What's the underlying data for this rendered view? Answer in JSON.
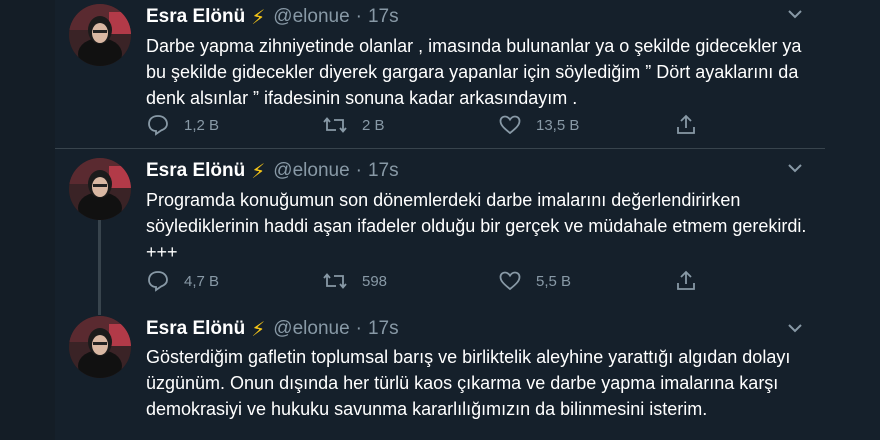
{
  "tweets": [
    {
      "name": "Esra Elönü",
      "badge": "⚡",
      "handle": "@elonue",
      "separator": "·",
      "time": "17s",
      "text": "Darbe yapma zihniyetinde olanlar , imasında bulunanlar ya o şekilde gidecekler ya bu şekilde gidecekler diyerek gargara yapanlar için söylediğim ” Dört ayaklarını da denk alsınlar ” ifadesinin sonuna kadar arkasındayım .",
      "replies": "1,2 B",
      "retweets": "2 B",
      "likes": "13,5 B"
    },
    {
      "name": "Esra Elönü",
      "badge": "⚡",
      "handle": "@elonue",
      "separator": "·",
      "time": "17s",
      "text": "Programda konuğumun son dönemlerdeki darbe imalarını değerlendirirken söylediklerinin haddi aşan ifadeler olduğu bir gerçek ve müdahale etmem gerekirdi. +++",
      "replies": "4,7 B",
      "retweets": "598",
      "likes": "5,5 B"
    },
    {
      "name": "Esra Elönü",
      "badge": "⚡",
      "handle": "@elonue",
      "separator": "·",
      "time": "17s",
      "text": "Gösterdiğim gafletin toplumsal barış ve birliktelik aleyhine yarattığı algıdan dolayı üzgünüm. Onun dışında her türlü kaos çıkarma ve darbe yapma imalarına karşı demokrasiyi ve hukuku savunma  kararlılığımızın da bilinmesini isterim."
    }
  ],
  "icons": {
    "reply": "reply-icon",
    "retweet": "retweet-icon",
    "like": "heart-icon",
    "share": "share-icon",
    "more": "chevron-down-icon",
    "verified": "lightning-icon"
  },
  "colors": {
    "background": "#15202b",
    "text": "#ffffff",
    "secondary": "#8899a6",
    "border": "#38444d",
    "badge": "#f5c518"
  }
}
